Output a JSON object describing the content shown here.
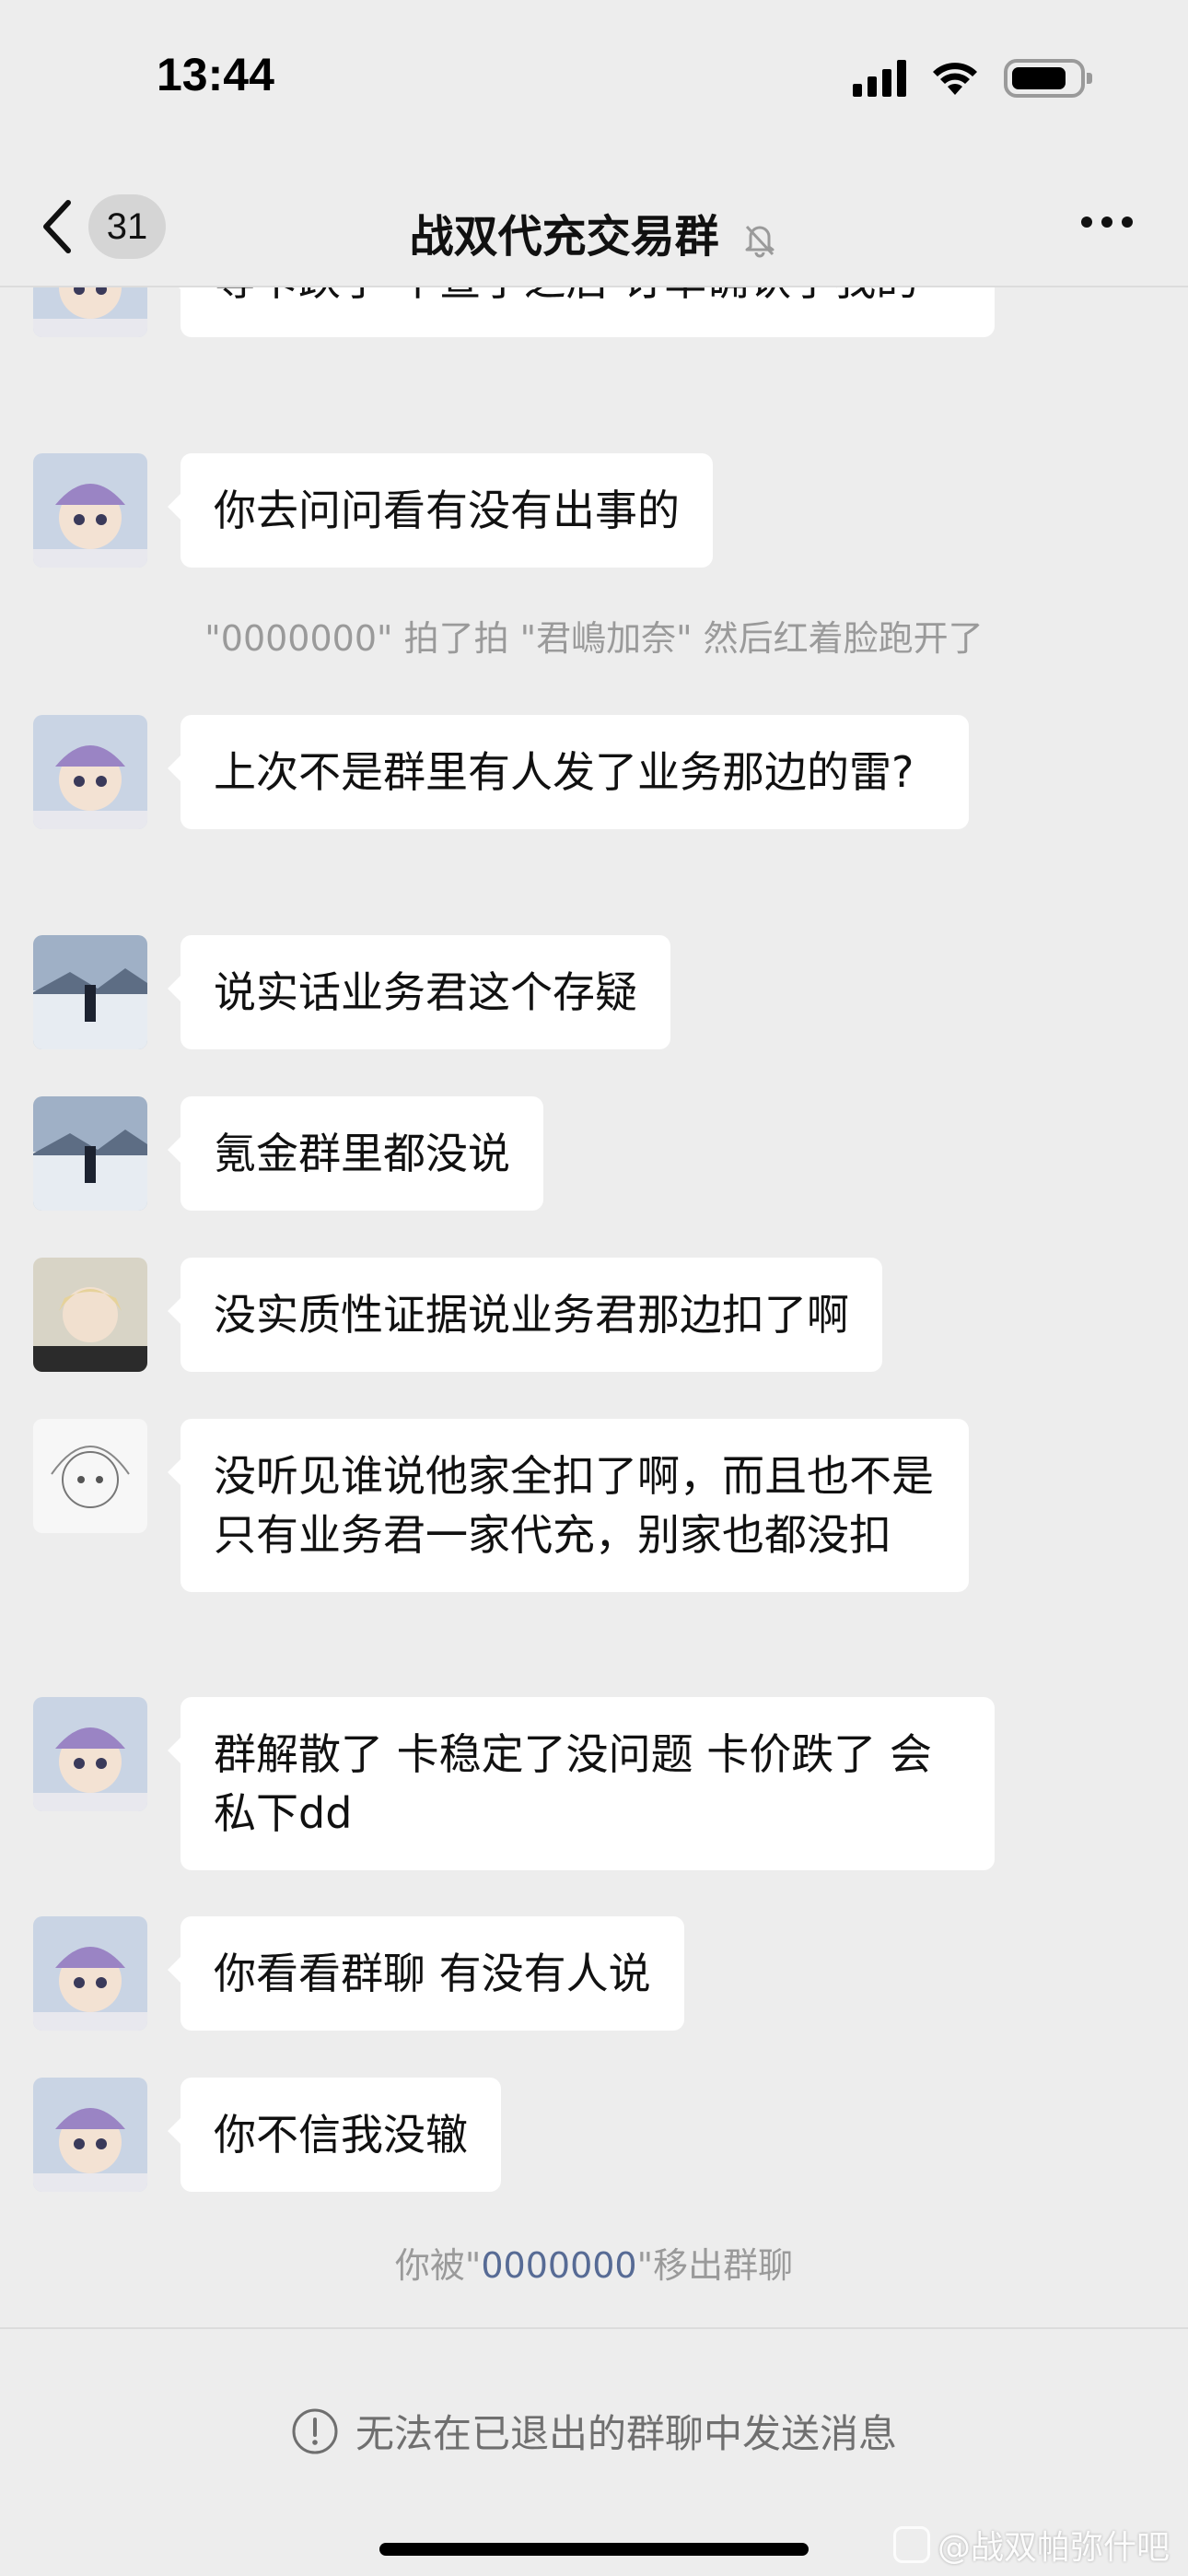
{
  "status_bar": {
    "time": "13:44"
  },
  "nav": {
    "back_count": "31",
    "title": "战双代充交易群"
  },
  "messages": [
    {
      "avatar": "avatar-anime-goggles",
      "text": "等卡跌了 不查了之后 订单确认了我的"
    },
    {
      "avatar": "avatar-anime-goggles",
      "text": "你去问问看有没有出事的"
    },
    {
      "avatar": "avatar-anime-goggles",
      "text": "上次不是群里有人发了业务那边的雷?"
    },
    {
      "avatar": "avatar-snow-landscape",
      "text": "说实话业务君这个存疑"
    },
    {
      "avatar": "avatar-snow-landscape",
      "text": "氪金群里都没说"
    },
    {
      "avatar": "avatar-blond-character",
      "text": "没实质性证据说业务君那边扣了啊"
    },
    {
      "avatar": "avatar-sketch-character",
      "text": "没听见谁说他家全扣了啊，而且也不是只有业务君一家代充，别家也都没扣"
    },
    {
      "avatar": "avatar-anime-goggles",
      "text": "群解散了 卡稳定了没问题 卡价跌了 会私下dd"
    },
    {
      "avatar": "avatar-anime-goggles",
      "text": "你看看群聊 有没有人说"
    },
    {
      "avatar": "avatar-anime-goggles",
      "text": "你不信我没辙"
    }
  ],
  "system_messages": {
    "pat": "\"0000000\" 拍了拍 \"君嶋加奈\" 然后红着脸跑开了",
    "removed_prefix": "你被\"",
    "removed_name": "0000000",
    "removed_suffix": "\"移出群聊"
  },
  "footer": {
    "notice": "无法在已退出的群聊中发送消息"
  },
  "watermark": "@战双帕弥什吧",
  "colors": {
    "background": "#ededed",
    "bubble": "#ffffff",
    "link": "#576b95",
    "system_text": "#9a9a9a"
  }
}
